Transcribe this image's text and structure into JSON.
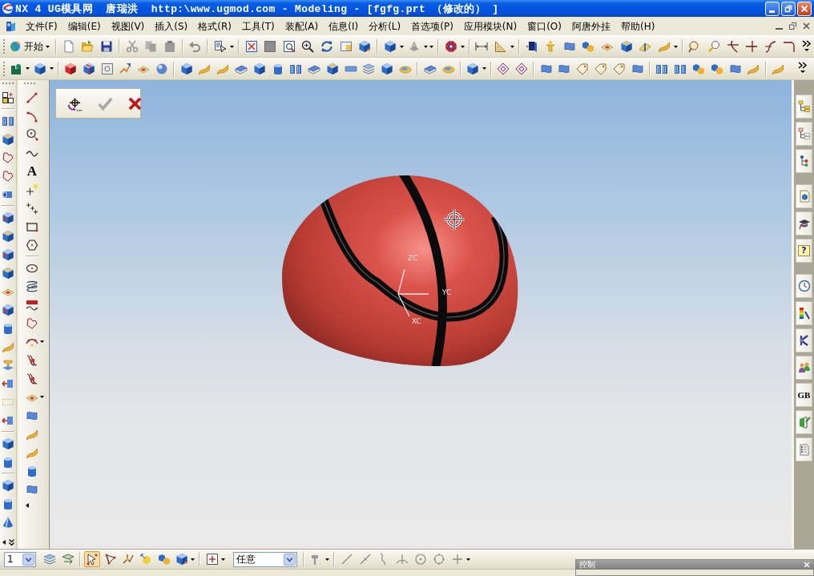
{
  "window": {
    "title": "NX 4 UG模具网  唐瑞洪  http:\\www.ugmod.com - Modeling - [fgfg.prt （修改的） ]"
  },
  "menu_bar": {
    "items": [
      "文件(F)",
      "编辑(E)",
      "视图(V)",
      "插入(S)",
      "格式(R)",
      "工具(T)",
      "装配(A)",
      "信息(I)",
      "分析(L)",
      "首选项(P)",
      "应用模块(N)",
      "窗口(O)",
      "阿唐外挂",
      "帮助(H)"
    ]
  },
  "standard_toolbar": {
    "start_button": "开始"
  },
  "curve_toolbar": {
    "text_tool": "A"
  },
  "point_dialog": {
    "ok_disabled": true
  },
  "viewport": {
    "axis_labels": [
      "ZC",
      "YC",
      "XC"
    ]
  },
  "resource_bar": {
    "help_button": "?",
    "language_button": "GB"
  },
  "selection_bar": {
    "layer": "1",
    "mode_buttons": [
      {
        "selected": true
      },
      {
        "selected": false
      },
      {
        "selected": false
      },
      {
        "selected": false
      },
      {
        "selected": false
      },
      {
        "selected": false
      }
    ],
    "filter": "任意"
  },
  "control_panel": {
    "title": "控制"
  }
}
